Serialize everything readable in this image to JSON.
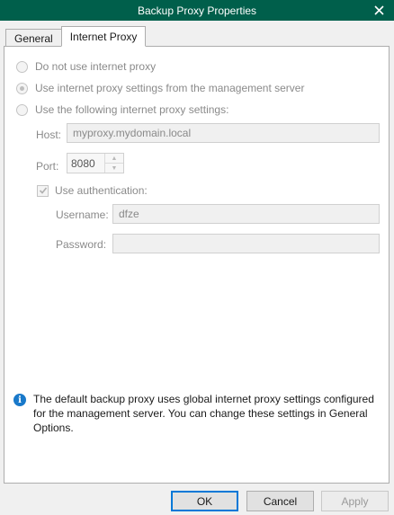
{
  "window": {
    "title": "Backup Proxy Properties"
  },
  "tabs": [
    {
      "label": "General"
    },
    {
      "label": "Internet Proxy"
    }
  ],
  "proxy": {
    "options": [
      {
        "label": "Do not use internet proxy",
        "checked": false
      },
      {
        "label": "Use internet proxy settings from the management server",
        "checked": true
      },
      {
        "label": "Use the following internet proxy settings:",
        "checked": false
      }
    ],
    "host_label": "Host:",
    "host_value": "myproxy.mydomain.local",
    "port_label": "Port:",
    "port_value": "8080",
    "auth_label": "Use authentication:",
    "auth_checked": true,
    "username_label": "Username:",
    "username_value": "dfze",
    "password_label": "Password:",
    "password_value": ""
  },
  "info": {
    "text": "The default backup proxy uses global internet proxy settings configured for the management server. You can change these settings in General Options."
  },
  "buttons": {
    "ok": "OK",
    "cancel": "Cancel",
    "apply": "Apply"
  }
}
